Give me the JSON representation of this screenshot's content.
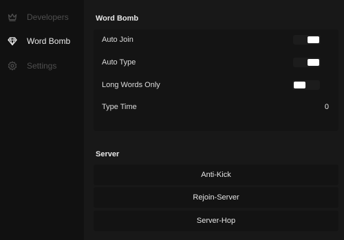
{
  "sidebar": {
    "items": [
      {
        "label": "Developers",
        "icon": "crown-icon"
      },
      {
        "label": "Word Bomb",
        "icon": "diamond-icon"
      },
      {
        "label": "Settings",
        "icon": "gear-icon"
      }
    ]
  },
  "word_bomb": {
    "title": "Word Bomb",
    "auto_join": {
      "label": "Auto Join",
      "enabled": true
    },
    "auto_type": {
      "label": "Auto Type",
      "enabled": true
    },
    "long_words_only": {
      "label": "Long Words Only",
      "enabled": false
    },
    "type_time": {
      "label": "Type Time",
      "value": "0"
    }
  },
  "server": {
    "title": "Server",
    "buttons": [
      "Anti-Kick",
      "Rejoin-Server",
      "Server-Hop"
    ]
  },
  "colors": {
    "background": "#111111",
    "panel": "#181818",
    "card": "#141414",
    "text_active": "#ececec",
    "text_dim": "#4f4f4f",
    "toggle_knob": "#ffffff"
  }
}
